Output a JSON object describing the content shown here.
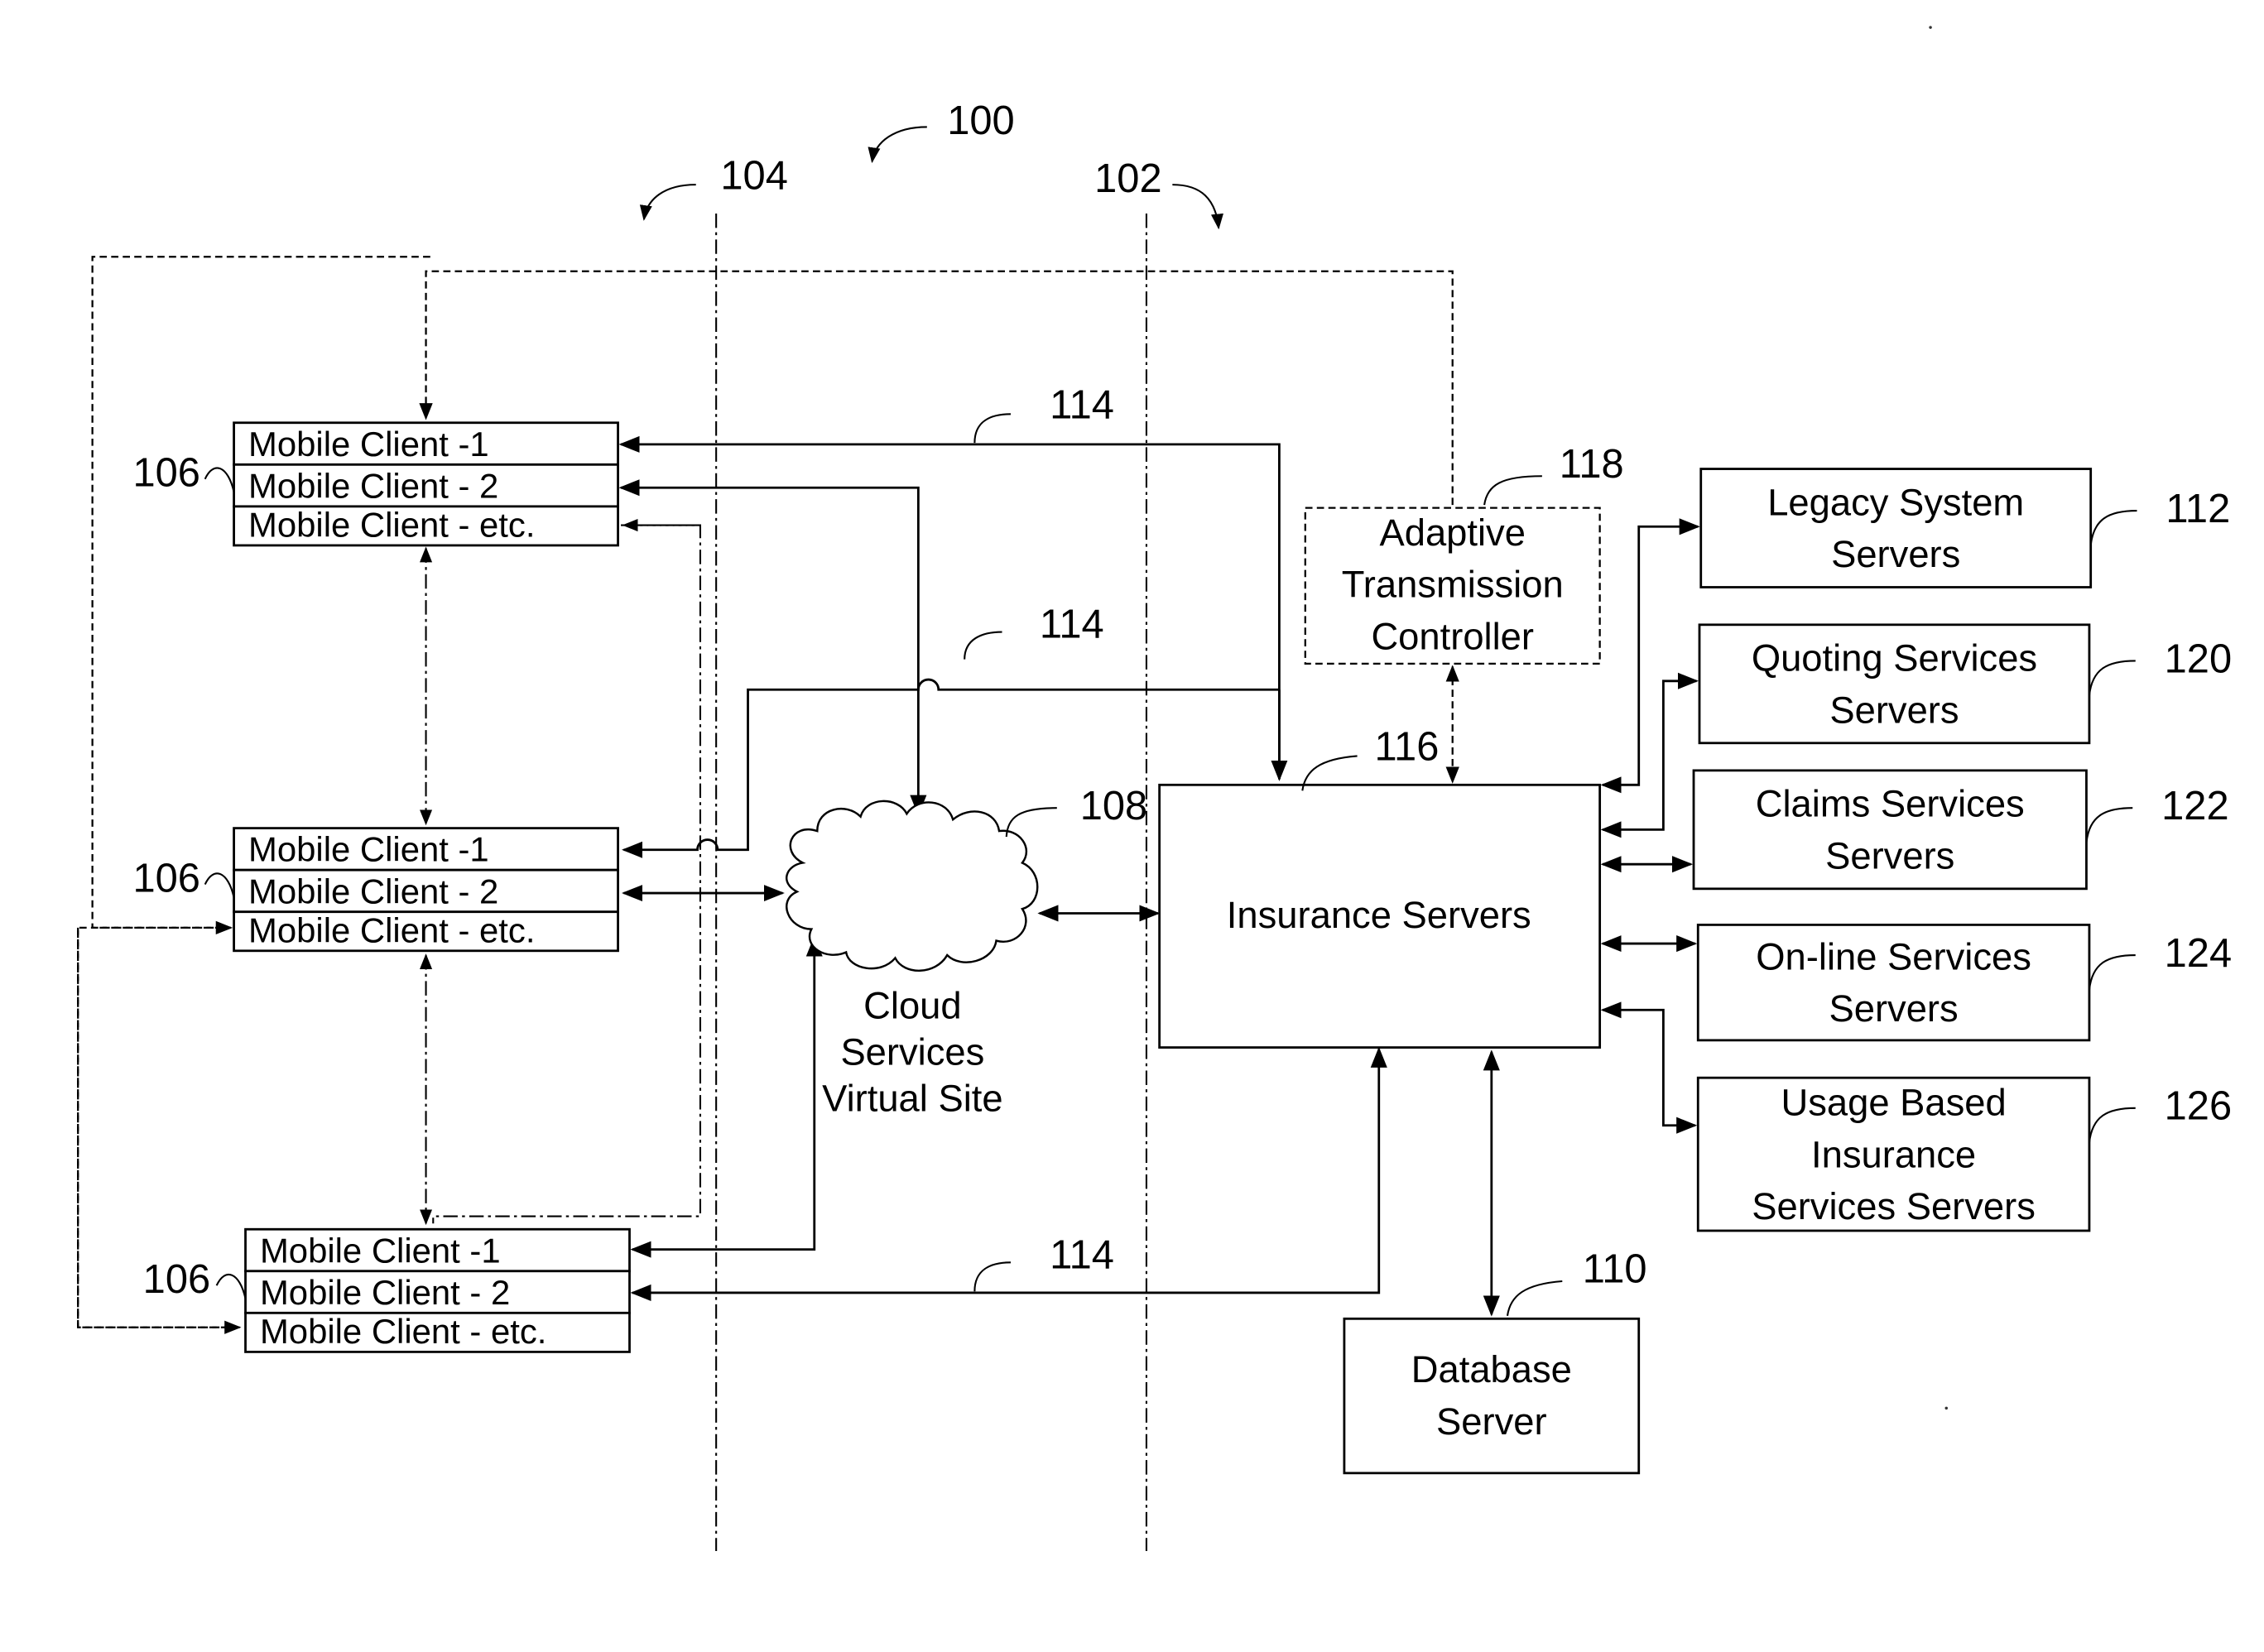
{
  "figure": {
    "reference": "100",
    "boundaries": [
      {
        "id": "104",
        "label": "104"
      },
      {
        "id": "102",
        "label": "102"
      }
    ]
  },
  "client_groups": [
    {
      "ref": "106",
      "rows": [
        "Mobile Client -1",
        "Mobile Client - 2",
        "Mobile Client - etc."
      ]
    },
    {
      "ref": "106",
      "rows": [
        "Mobile Client -1",
        "Mobile Client - 2",
        "Mobile Client - etc."
      ]
    },
    {
      "ref": "106",
      "rows": [
        "Mobile Client -1",
        "Mobile Client - 2",
        "Mobile Client - etc."
      ]
    }
  ],
  "cloud": {
    "ref": "108",
    "lines": [
      "Cloud",
      "Services",
      "Virtual Site"
    ]
  },
  "connection_refs": [
    "114",
    "114",
    "114"
  ],
  "controller": {
    "ref": "118",
    "lines": [
      "Adaptive",
      "Transmission",
      "Controller"
    ]
  },
  "insurance_servers": {
    "ref": "116",
    "label": "Insurance Servers"
  },
  "database_server": {
    "ref": "110",
    "lines": [
      "Database",
      "Server"
    ]
  },
  "service_servers": [
    {
      "ref": "112",
      "lines": [
        "Legacy System",
        "Servers"
      ]
    },
    {
      "ref": "120",
      "lines": [
        "Quoting Services",
        "Servers"
      ]
    },
    {
      "ref": "122",
      "lines": [
        "Claims Services",
        "Servers"
      ]
    },
    {
      "ref": "124",
      "lines": [
        "On-line Services",
        "Servers"
      ]
    },
    {
      "ref": "126",
      "lines": [
        "Usage Based",
        "Insurance",
        "Services Servers"
      ]
    }
  ]
}
